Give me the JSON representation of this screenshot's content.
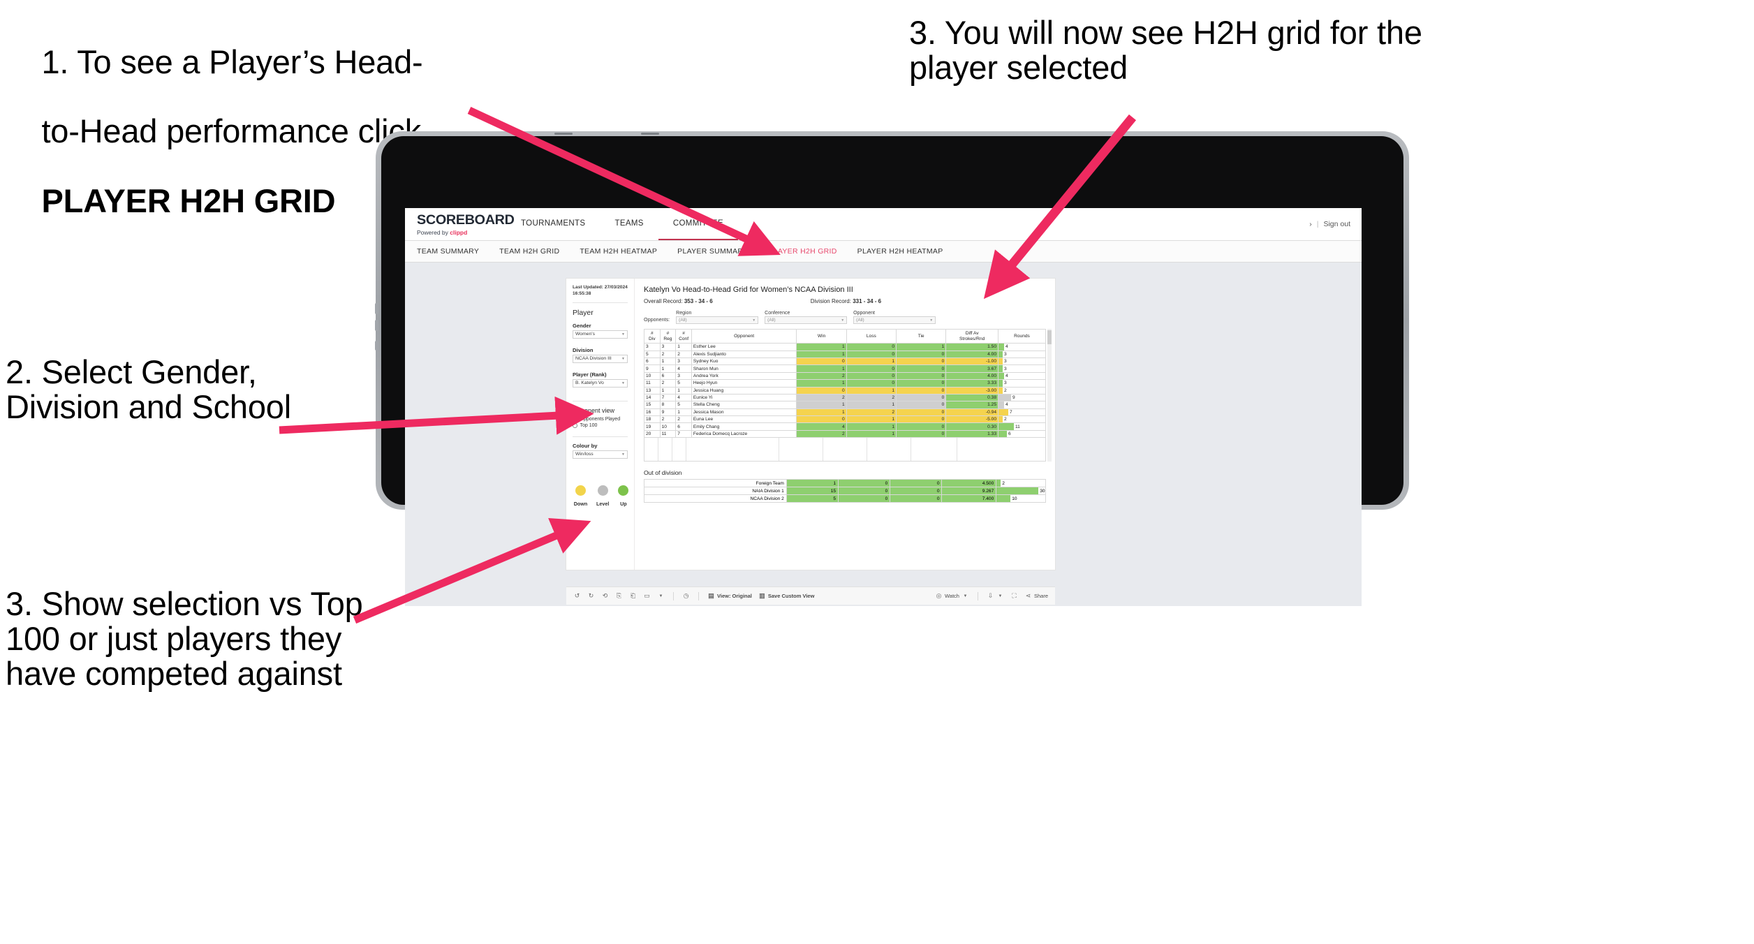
{
  "annotations": [
    {
      "id": "a1",
      "line1": "1. To see a Player’s Head-",
      "line2": "to-Head performance click",
      "bold": "PLAYER H2H GRID"
    },
    {
      "id": "a2",
      "text": "2. Select Gender, Division and School"
    },
    {
      "id": "a3",
      "text": "3. Show selection vs Top 100 or just players they have competed against"
    },
    {
      "id": "a4",
      "text": "3. You will now see H2H grid for the player selected"
    }
  ],
  "app": {
    "logo": {
      "main": "SCOREBOARD",
      "sub_prefix": "Powered by ",
      "sub_brand": "clippd"
    },
    "topnav": [
      {
        "label": "TOURNAMENTS",
        "active": false
      },
      {
        "label": "TEAMS",
        "active": false
      },
      {
        "label": "COMMITTEE",
        "active": true
      }
    ],
    "header_right": {
      "chevron": "›",
      "separator": "|",
      "signout": "Sign out"
    },
    "subnav": [
      {
        "label": "TEAM SUMMARY",
        "active": false
      },
      {
        "label": "TEAM H2H GRID",
        "active": false
      },
      {
        "label": "TEAM H2H HEATMAP",
        "active": false
      },
      {
        "label": "PLAYER SUMMARY",
        "active": false
      },
      {
        "label": "PLAYER H2H GRID",
        "active": true
      },
      {
        "label": "PLAYER H2H HEATMAP",
        "active": false
      }
    ]
  },
  "pane": {
    "updated_line1": "Last Updated: 27/03/2024",
    "updated_line2": "16:55:38",
    "heading": "Player",
    "fields": [
      {
        "label": "Gender",
        "value": "Women's"
      },
      {
        "label": "Division",
        "value": "NCAA Division III"
      },
      {
        "label": "Player (Rank)",
        "value": "B. Katelyn Vo"
      }
    ],
    "opponent_view": {
      "heading": "Opponent view",
      "options": [
        {
          "label": "Opponents Played",
          "selected": true
        },
        {
          "label": "Top 100",
          "selected": false
        }
      ]
    },
    "colour_by": {
      "label": "Colour by",
      "value": "Win/loss"
    },
    "legend": [
      {
        "caption": "Down",
        "color": "#f2d44b"
      },
      {
        "caption": "Level",
        "color": "#bdbdbd"
      },
      {
        "caption": "Up",
        "color": "#7dc24b"
      }
    ]
  },
  "viz": {
    "title": "Katelyn Vo Head-to-Head Grid for Women’s NCAA Division III",
    "overall_record_label": "Overall Record:",
    "overall_record_value": "353 - 34 - 6",
    "division_record_label": "Division Record:",
    "division_record_value": "331 - 34 - 6",
    "opponents_label": "Opponents:",
    "opponent_filters": [
      {
        "caption": "Region",
        "value": "(All)"
      },
      {
        "caption": "Conference",
        "value": "(All)"
      },
      {
        "caption": "Opponent",
        "value": "(All)"
      }
    ],
    "columns": [
      {
        "l1": "#",
        "l2": "Div"
      },
      {
        "l1": "#",
        "l2": "Reg"
      },
      {
        "l1": "#",
        "l2": "Conf"
      },
      {
        "l1": "Opponent",
        "l2": ""
      },
      {
        "l1": "Win",
        "l2": ""
      },
      {
        "l1": "Loss",
        "l2": ""
      },
      {
        "l1": "Tie",
        "l2": ""
      },
      {
        "l1": "Diff Av",
        "l2": "Strokes/Rnd"
      },
      {
        "l1": "Rounds",
        "l2": ""
      }
    ],
    "out_of_division_title": "Out of division"
  },
  "chart_data": {
    "type": "table",
    "title": "Katelyn Vo Head-to-Head Grid for Women’s NCAA Division III",
    "columns": [
      "# Div",
      "# Reg",
      "# Conf",
      "Opponent",
      "Win",
      "Loss",
      "Tie",
      "Diff Av Strokes/Rnd",
      "Rounds"
    ],
    "rounds_max": 30,
    "rows": [
      {
        "div": "3",
        "reg": "3",
        "conf": "1",
        "opponent": "Esther Lee",
        "win": "1",
        "loss": "0",
        "tie": "1",
        "diff": "1.50",
        "rounds": 4,
        "state": "up"
      },
      {
        "div": "5",
        "reg": "2",
        "conf": "2",
        "opponent": "Alexis Sudjianto",
        "win": "1",
        "loss": "0",
        "tie": "0",
        "diff": "4.00",
        "rounds": 3,
        "state": "up"
      },
      {
        "div": "6",
        "reg": "1",
        "conf": "3",
        "opponent": "Sydney Kuo",
        "win": "0",
        "loss": "1",
        "tie": "0",
        "diff": "-1.00",
        "rounds": 3,
        "state": "down"
      },
      {
        "div": "9",
        "reg": "1",
        "conf": "4",
        "opponent": "Sharon Mun",
        "win": "1",
        "loss": "0",
        "tie": "0",
        "diff": "3.67",
        "rounds": 3,
        "state": "up"
      },
      {
        "div": "10",
        "reg": "6",
        "conf": "3",
        "opponent": "Andrea York",
        "win": "2",
        "loss": "0",
        "tie": "0",
        "diff": "4.00",
        "rounds": 4,
        "state": "up"
      },
      {
        "div": "11",
        "reg": "2",
        "conf": "5",
        "opponent": "Heejo Hyun",
        "win": "1",
        "loss": "0",
        "tie": "0",
        "diff": "3.33",
        "rounds": 3,
        "state": "up"
      },
      {
        "div": "13",
        "reg": "1",
        "conf": "1",
        "opponent": "Jessica Huang",
        "win": "0",
        "loss": "1",
        "tie": "0",
        "diff": "-3.00",
        "rounds": 2,
        "state": "down"
      },
      {
        "div": "14",
        "reg": "7",
        "conf": "4",
        "opponent": "Eunice Yi",
        "win": "2",
        "loss": "2",
        "tie": "0",
        "diff": "0.38",
        "rounds": 9,
        "state": "level"
      },
      {
        "div": "15",
        "reg": "8",
        "conf": "5",
        "opponent": "Stella Cheng",
        "win": "1",
        "loss": "1",
        "tie": "0",
        "diff": "1.25",
        "rounds": 4,
        "state": "level"
      },
      {
        "div": "16",
        "reg": "9",
        "conf": "1",
        "opponent": "Jessica Mason",
        "win": "1",
        "loss": "2",
        "tie": "0",
        "diff": "-0.94",
        "rounds": 7,
        "state": "down"
      },
      {
        "div": "18",
        "reg": "2",
        "conf": "2",
        "opponent": "Euna Lee",
        "win": "0",
        "loss": "1",
        "tie": "0",
        "diff": "-5.00",
        "rounds": 2,
        "state": "down"
      },
      {
        "div": "19",
        "reg": "10",
        "conf": "6",
        "opponent": "Emily Chang",
        "win": "4",
        "loss": "1",
        "tie": "0",
        "diff": "0.30",
        "rounds": 11,
        "state": "up"
      },
      {
        "div": "20",
        "reg": "11",
        "conf": "7",
        "opponent": "Federica Domecq Lacroze",
        "win": "2",
        "loss": "1",
        "tie": "0",
        "diff": "1.33",
        "rounds": 6,
        "state": "up"
      }
    ],
    "out_of_division": [
      {
        "label": "Foreign Team",
        "win": "1",
        "loss": "0",
        "tie": "0",
        "diff": "4.500",
        "rounds": 2,
        "state": "up"
      },
      {
        "label": "NAIA Division 1",
        "win": "15",
        "loss": "0",
        "tie": "0",
        "diff": "9.267",
        "rounds": 30,
        "state": "up"
      },
      {
        "label": "NCAA Division 2",
        "win": "5",
        "loss": "0",
        "tie": "0",
        "diff": "7.400",
        "rounds": 10,
        "state": "up"
      }
    ]
  },
  "toolbar": {
    "icons": [
      "undo-icon",
      "redo-icon",
      "revert-icon",
      "refresh-icon",
      "pause-icon",
      "alerts-icon",
      "dropdown-caret-icon"
    ],
    "clock_icon": "clock-icon",
    "view_label": "View: Original",
    "save_label": "Save Custom View",
    "watch_label": "Watch",
    "download_icon": "download-icon",
    "fullscreen_icon": "fullscreen-icon",
    "share_label": "Share"
  },
  "colors": {
    "accent_pink": "#ee2a60",
    "up_green": "#8ecf6f",
    "down_yellow": "#f5d34e",
    "level_gray": "#cfcfcf",
    "nav_active": "#e8496d"
  }
}
